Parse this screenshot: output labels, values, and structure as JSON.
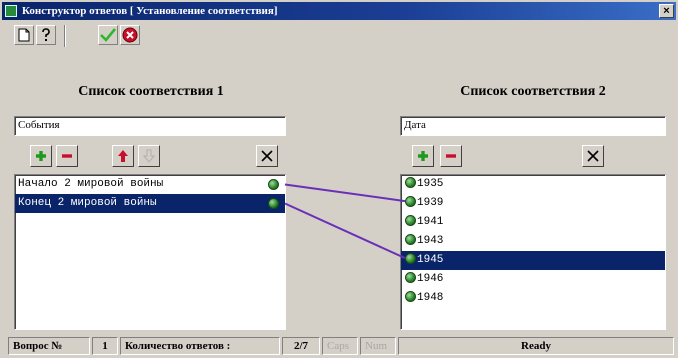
{
  "window": {
    "title": "Конструктор ответов  [ Установление соответствия]",
    "close_label": "×"
  },
  "toolbar": {
    "new_icon": "document-icon",
    "help_icon": "help-icon",
    "ok_icon": "checkmark-icon",
    "stop_icon": "stop-icon",
    "ok_color": "#2db82d",
    "stop_color": "#c8102e"
  },
  "left_panel": {
    "title": "Список соответствия 1",
    "field_value": "События",
    "buttons": {
      "add": "+",
      "remove": "−",
      "up": "↑",
      "down": "↓",
      "clear": "✕"
    },
    "items": [
      {
        "label": "Начало 2 мировой войны",
        "selected": false
      },
      {
        "label": "Конец 2 мировой войны",
        "selected": true
      }
    ]
  },
  "right_panel": {
    "title": "Список соответствия 2",
    "field_value": "Дата",
    "buttons": {
      "add": "+",
      "remove": "−",
      "clear": "✕"
    },
    "items": [
      {
        "label": "1935",
        "selected": false
      },
      {
        "label": "1939",
        "selected": false
      },
      {
        "label": "1941",
        "selected": false
      },
      {
        "label": "1943",
        "selected": false
      },
      {
        "label": "1945",
        "selected": true
      },
      {
        "label": "1946",
        "selected": false
      },
      {
        "label": "1948",
        "selected": false
      }
    ]
  },
  "links": [
    {
      "from": 0,
      "to": 1
    },
    {
      "from": 1,
      "to": 4
    }
  ],
  "colors": {
    "selection": "#0a246a",
    "link_line": "#6a2fb8",
    "add_green": "#1d9a1d",
    "remove_red": "#c8102e"
  },
  "statusbar": {
    "question_label": "Вопрос №",
    "question_value": "1",
    "answers_label": "Количество ответов :",
    "answers_value": "2/7",
    "caps": "Caps",
    "num": "Num",
    "status": "Ready"
  }
}
